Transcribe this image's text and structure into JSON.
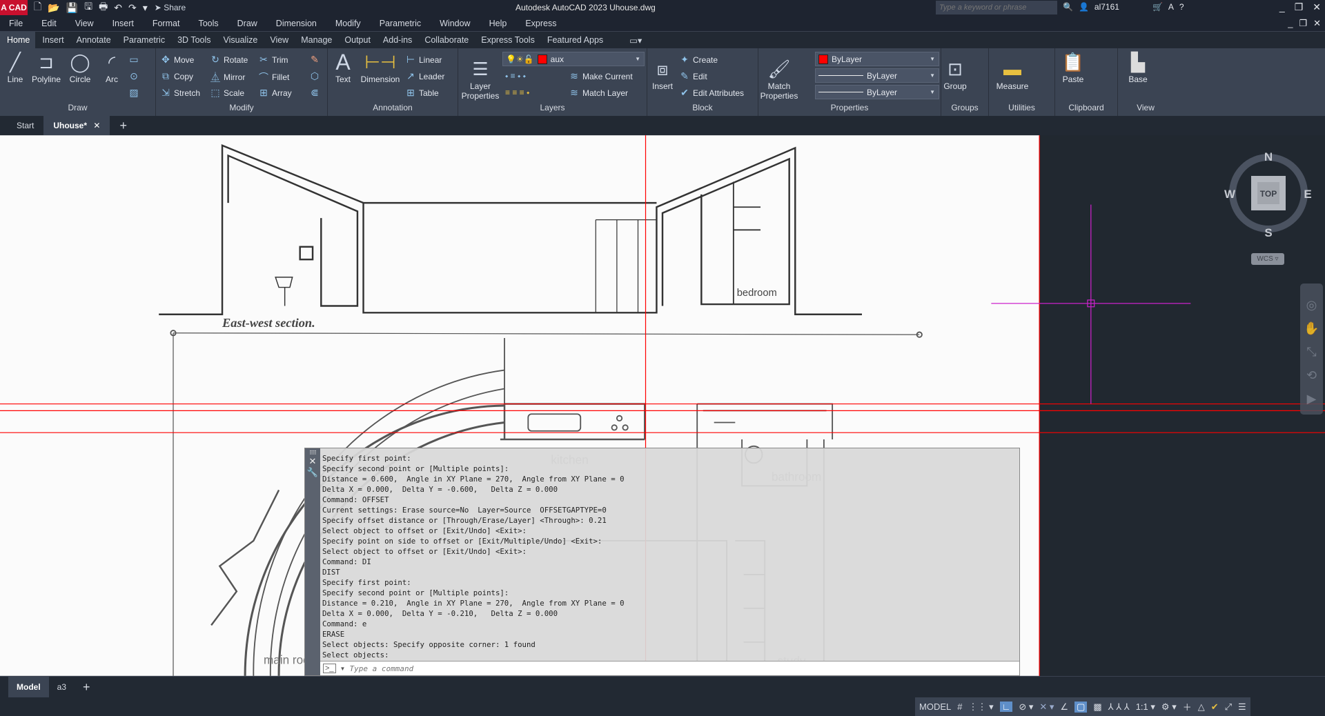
{
  "titlebar": {
    "app_badge": "A CAD",
    "share": "Share",
    "title": "Autodesk AutoCAD 2023   Uhouse.dwg",
    "search_placeholder": "Type a keyword or phrase",
    "user": "al7161"
  },
  "menus": [
    "File",
    "Edit",
    "View",
    "Insert",
    "Format",
    "Tools",
    "Draw",
    "Dimension",
    "Modify",
    "Parametric",
    "Window",
    "Help",
    "Express"
  ],
  "ribbon_tabs": [
    "Home",
    "Insert",
    "Annotate",
    "Parametric",
    "3D Tools",
    "Visualize",
    "View",
    "Manage",
    "Output",
    "Add-ins",
    "Collaborate",
    "Express Tools",
    "Featured Apps"
  ],
  "panels": {
    "draw": {
      "label": "Draw",
      "items": [
        "Line",
        "Polyline",
        "Circle",
        "Arc"
      ]
    },
    "modify": {
      "label": "Modify",
      "items": [
        "Move",
        "Rotate",
        "Trim",
        "Copy",
        "Mirror",
        "Fillet",
        "Stretch",
        "Scale",
        "Array"
      ]
    },
    "annotation": {
      "label": "Annotation",
      "items": [
        "Text",
        "Dimension",
        "Linear",
        "Leader",
        "Table"
      ]
    },
    "layers": {
      "label": "Layers",
      "layer_properties": "Layer Properties",
      "current_layer": "aux",
      "make_current": "Make Current",
      "match_layer": "Match Layer"
    },
    "block": {
      "label": "Block",
      "items": [
        "Insert",
        "Create",
        "Edit",
        "Edit Attributes"
      ]
    },
    "properties": {
      "label": "Properties",
      "match": "Match Properties",
      "color": "ByLayer",
      "linetype": "ByLayer",
      "lineweight": "ByLayer"
    },
    "groups": {
      "label": "Groups",
      "group": "Group"
    },
    "utilities": {
      "label": "Utilities",
      "measure": "Measure"
    },
    "clipboard": {
      "label": "Clipboard",
      "paste": "Paste"
    },
    "view": {
      "label": "View",
      "base": "Base"
    }
  },
  "file_tabs": [
    "Start",
    "Uhouse*"
  ],
  "drawing_labels": {
    "section": "East-west section.",
    "bedroom": "bedroom",
    "kitchen": "kitchen",
    "bathroom": "bathroom",
    "main_room": "main room",
    "study": "study"
  },
  "viewcube": {
    "n": "N",
    "s": "S",
    "e": "E",
    "w": "W",
    "face": "TOP",
    "ucs": "WCS"
  },
  "command": {
    "history": [
      "Specify first point:",
      "Specify second point or [Multiple points]:",
      "Distance = 0.600,  Angle in XY Plane = 270,  Angle from XY Plane = 0",
      "Delta X = 0.000,  Delta Y = -0.600,   Delta Z = 0.000",
      "Command: OFFSET",
      "Current settings: Erase source=No  Layer=Source  OFFSETGAPTYPE=0",
      "Specify offset distance or [Through/Erase/Layer] <Through>: 0.21",
      "Select object to offset or [Exit/Undo] <Exit>:",
      "Specify point on side to offset or [Exit/Multiple/Undo] <Exit>:",
      "Select object to offset or [Exit/Undo] <Exit>:",
      "Command: DI",
      "DIST",
      "Specify first point:",
      "Specify second point or [Multiple points]:",
      "Distance = 0.210,  Angle in XY Plane = 270,  Angle from XY Plane = 0",
      "Delta X = 0.000,  Delta Y = -0.210,   Delta Z = 0.000",
      "Command: e",
      "ERASE",
      "Select objects: Specify opposite corner: 1 found",
      "Select objects:"
    ],
    "placeholder": "Type a command"
  },
  "layout_tabs": [
    "Model",
    "a3"
  ],
  "status": {
    "model": "MODEL",
    "scale": "1:1"
  },
  "colors": {
    "accent_red": "#ff0000",
    "crosshair": "#cc22cc",
    "ribbon_bg": "#3b4453"
  }
}
